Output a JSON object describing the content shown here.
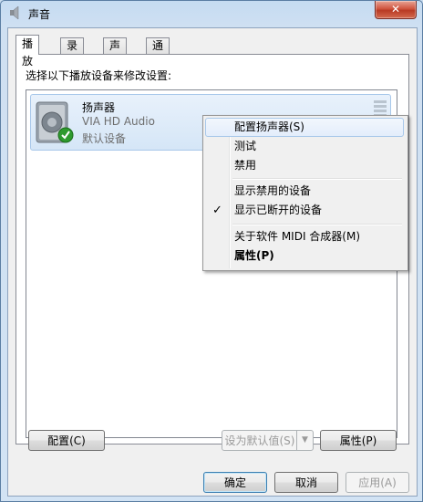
{
  "window": {
    "title": "声音",
    "close_glyph": "✕"
  },
  "tabs": [
    {
      "label": "播放"
    },
    {
      "label": "录制"
    },
    {
      "label": "声音"
    },
    {
      "label": "通信"
    }
  ],
  "instruction": "选择以下播放设备来修改设置:",
  "device": {
    "name": "扬声器",
    "driver": "VIA HD Audio",
    "status": "默认设备",
    "icon": "speaker-icon",
    "badge_icon": "green-check-icon"
  },
  "context_menu": {
    "items": [
      {
        "label": "配置扬声器(S)"
      },
      {
        "label": "测试"
      },
      {
        "label": "禁用"
      },
      {
        "label": "显示禁用的设备"
      },
      {
        "label": "显示已断开的设备",
        "checked": true,
        "check_glyph": "✓"
      },
      {
        "label": "关于软件 MIDI 合成器(M)"
      },
      {
        "label": "属性(P)"
      }
    ]
  },
  "buttons": {
    "configure": "配置(C)",
    "set_default": "设为默认值(S)",
    "set_default_arrow": "▼",
    "properties": "属性(P)",
    "ok": "确定",
    "cancel": "取消",
    "apply": "应用(A)"
  },
  "colors": {
    "accent": "#3c7fb1",
    "close_red": "#c8452f",
    "check_green": "#2e9a2e"
  }
}
